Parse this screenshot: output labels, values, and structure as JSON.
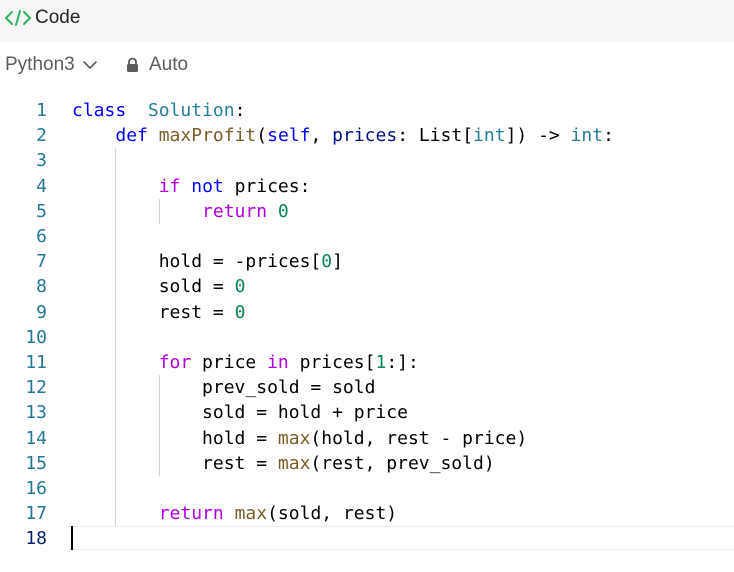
{
  "header": {
    "title": "Code",
    "icon": "code-icon"
  },
  "toolbar": {
    "language": "Python3",
    "mode_label": "Auto"
  },
  "editor": {
    "active_line": 18,
    "lines": [
      {
        "n": "1",
        "tokens": [
          [
            "kw",
            "class"
          ],
          [
            "",
            "  "
          ],
          [
            "cls",
            "Solution"
          ],
          [
            "",
            ":"
          ]
        ]
      },
      {
        "n": "2",
        "tokens": [
          [
            "",
            "    "
          ],
          [
            "kw",
            "def"
          ],
          [
            "",
            " "
          ],
          [
            "fn",
            "maxProfit"
          ],
          [
            "",
            "("
          ],
          [
            "slf",
            "self"
          ],
          [
            "",
            ", "
          ],
          [
            "prm",
            "prices"
          ],
          [
            "",
            ": List["
          ],
          [
            "typ",
            "int"
          ],
          [
            "",
            "]) -> "
          ],
          [
            "typ",
            "int"
          ],
          [
            "",
            ":"
          ]
        ]
      },
      {
        "n": "3",
        "tokens": []
      },
      {
        "n": "4",
        "tokens": [
          [
            "",
            "        "
          ],
          [
            "kw2",
            "if"
          ],
          [
            "",
            " "
          ],
          [
            "kw",
            "not"
          ],
          [
            "",
            " prices:"
          ]
        ]
      },
      {
        "n": "5",
        "tokens": [
          [
            "",
            "            "
          ],
          [
            "kw2",
            "return"
          ],
          [
            "",
            " "
          ],
          [
            "num",
            "0"
          ]
        ]
      },
      {
        "n": "6",
        "tokens": []
      },
      {
        "n": "7",
        "tokens": [
          [
            "",
            "        hold = -prices["
          ],
          [
            "num",
            "0"
          ],
          [
            "",
            "]"
          ]
        ]
      },
      {
        "n": "8",
        "tokens": [
          [
            "",
            "        sold = "
          ],
          [
            "num",
            "0"
          ]
        ]
      },
      {
        "n": "9",
        "tokens": [
          [
            "",
            "        rest = "
          ],
          [
            "num",
            "0"
          ]
        ]
      },
      {
        "n": "10",
        "tokens": []
      },
      {
        "n": "11",
        "tokens": [
          [
            "",
            "        "
          ],
          [
            "kw2",
            "for"
          ],
          [
            "",
            " price "
          ],
          [
            "kw2",
            "in"
          ],
          [
            "",
            " prices["
          ],
          [
            "num",
            "1"
          ],
          [
            "",
            ":]:"
          ]
        ]
      },
      {
        "n": "12",
        "tokens": [
          [
            "",
            "            prev_sold = sold"
          ]
        ]
      },
      {
        "n": "13",
        "tokens": [
          [
            "",
            "            sold = hold + price"
          ]
        ]
      },
      {
        "n": "14",
        "tokens": [
          [
            "",
            "            hold = "
          ],
          [
            "bi",
            "max"
          ],
          [
            "",
            "(hold, rest - price)"
          ]
        ]
      },
      {
        "n": "15",
        "tokens": [
          [
            "",
            "            rest = "
          ],
          [
            "bi",
            "max"
          ],
          [
            "",
            "(rest, prev_sold)"
          ]
        ]
      },
      {
        "n": "16",
        "tokens": []
      },
      {
        "n": "17",
        "tokens": [
          [
            "",
            "        "
          ],
          [
            "kw2",
            "return"
          ],
          [
            "",
            " "
          ],
          [
            "bi",
            "max"
          ],
          [
            "",
            "(sold, rest)"
          ]
        ]
      },
      {
        "n": "18",
        "tokens": []
      }
    ]
  }
}
